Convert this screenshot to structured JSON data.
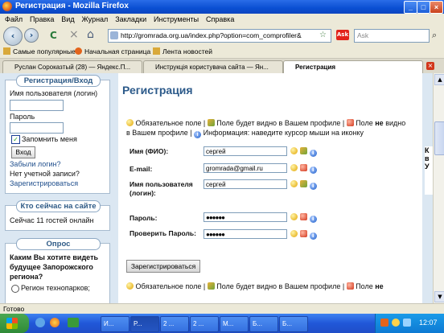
{
  "window": {
    "title": "Регистрация - Mozilla Firefox",
    "minimize": "_",
    "maximize": "□",
    "close": "×"
  },
  "menu": [
    "Файл",
    "Правка",
    "Вид",
    "Журнал",
    "Закладки",
    "Инструменты",
    "Справка"
  ],
  "nav": {
    "back": "‹",
    "forward": "›",
    "reload": "C",
    "stop": "×",
    "home": "⌂",
    "url": "http://gromrada.org.ua/index.php?option=com_comprofiler&",
    "search_placeholder": "Ask"
  },
  "bookmarks": [
    "Самые популярные",
    "Начальная страница",
    "Лента новостей"
  ],
  "tabs": [
    "Руслан Сороказтый (28) — Яндекс.П...",
    "Инструкція користувача сайта — Ян...",
    "Регистрация"
  ],
  "sidebar": {
    "login": {
      "title": "Регистрация/Вход",
      "username_label": "Имя пользователя (логин)",
      "password_label": "Пароль",
      "remember_label": "Запомнить меня",
      "login_button": "Вход",
      "forgot_link": "Забыли логин?",
      "no_account": "Нет учетной записи?",
      "register_link": "Зарегистрироваться"
    },
    "online": {
      "title": "Кто сейчас на сайте",
      "text": "Сейчас 11 гостей онлайн"
    },
    "poll": {
      "title": "Опрос",
      "question": "Каким Вы хотите видеть будущее Запорожского региона?",
      "option1": "Регион технопарков;"
    }
  },
  "main": {
    "heading": "Регистрация",
    "legend": {
      "required": "Обязательное поле",
      "visible": "Поле будет видно в Вашем профиле",
      "not_visible_1": "Поле",
      "not_word": "не",
      "not_visible_2": "видно в Вашем профиле",
      "info": "Информация: наведите курсор мыши на иконку"
    },
    "fields": [
      {
        "label": "Имя (ФИО):",
        "value": "сергей"
      },
      {
        "label": "E-mail:",
        "value": "gromrada@gmail.ru"
      },
      {
        "label": "Имя пользователя (логин):",
        "value": "сергей"
      },
      {
        "label": "Пароль:",
        "value": "●●●●●●"
      },
      {
        "label": "Проверить Пароль:",
        "value": "●●●●●●"
      }
    ],
    "submit_button": "Зарегистрироваться",
    "legend_bottom": {
      "required": "Обязательное поле",
      "visible": "Поле будет видно в Вашем профиле",
      "not_visible": "Поле",
      "not_word": "не"
    }
  },
  "right_partial": {
    "letter1": "К",
    "letter2": "в",
    "letter3": "У"
  },
  "status": {
    "text": "Готово"
  },
  "taskbar": {
    "start": "",
    "items": [
      "И...",
      "Р...",
      "2 ...",
      "2 ...",
      "М...",
      "Б...",
      "Б..."
    ],
    "clock": "12:07"
  }
}
